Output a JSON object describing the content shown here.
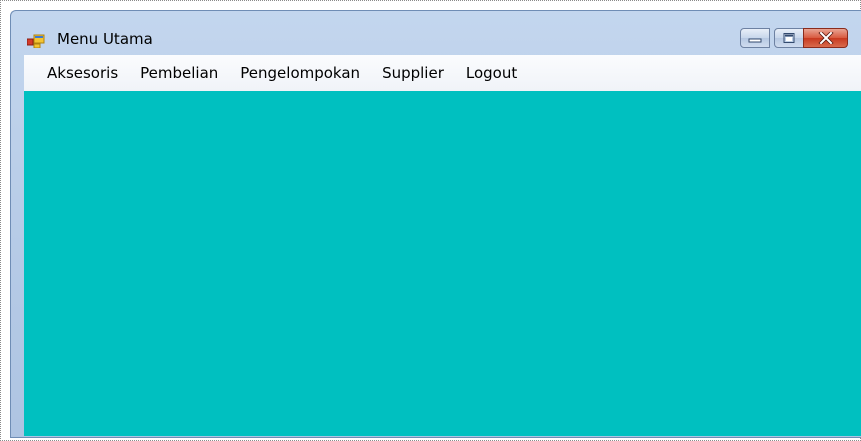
{
  "window": {
    "title": "Menu Utama",
    "client_color": "#00C0C0",
    "icons": {
      "app": "windows-form-icon",
      "minimize": "minimize-icon",
      "maximize": "maximize-icon",
      "close": "close-icon"
    }
  },
  "menu": {
    "items": [
      {
        "label": "Aksesoris"
      },
      {
        "label": "Pembelian"
      },
      {
        "label": "Pengelompokan"
      },
      {
        "label": "Supplier"
      },
      {
        "label": "Logout"
      }
    ]
  }
}
